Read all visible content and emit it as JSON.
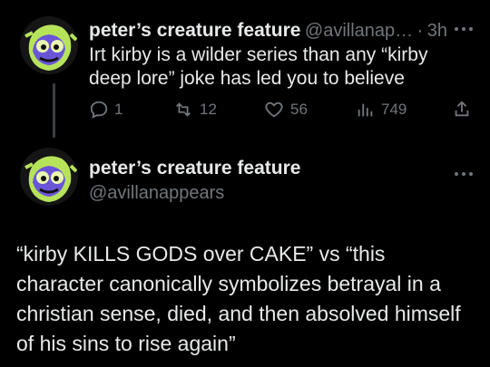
{
  "reply": {
    "author_name": "peter’s creature feature",
    "handle_truncated": "@avillanap…",
    "separator": "·",
    "time": "3h",
    "text_lines": [
      "Irt kirby is a wilder series than any “kirby",
      "deep lore” joke has led you to believe"
    ],
    "actions": {
      "replies": "1",
      "reposts": "12",
      "likes": "56",
      "views": "749"
    }
  },
  "main": {
    "author_name": "peter’s creature feature",
    "handle": "@avillanappears",
    "text_lines": [
      "“kirby KILLS GODS over CAKE” vs “this",
      "character canonically symbolizes betrayal in a",
      "christian sense, died, and then absolved himself",
      "of his sins to rise again”"
    ]
  },
  "more_icon": "more-dots-icon",
  "colors": {
    "background": "#000000",
    "text": "#e7e9ea",
    "secondary": "#71767b",
    "avatar_bg": "#b7e35a",
    "avatar_face": "#6a55d9"
  }
}
